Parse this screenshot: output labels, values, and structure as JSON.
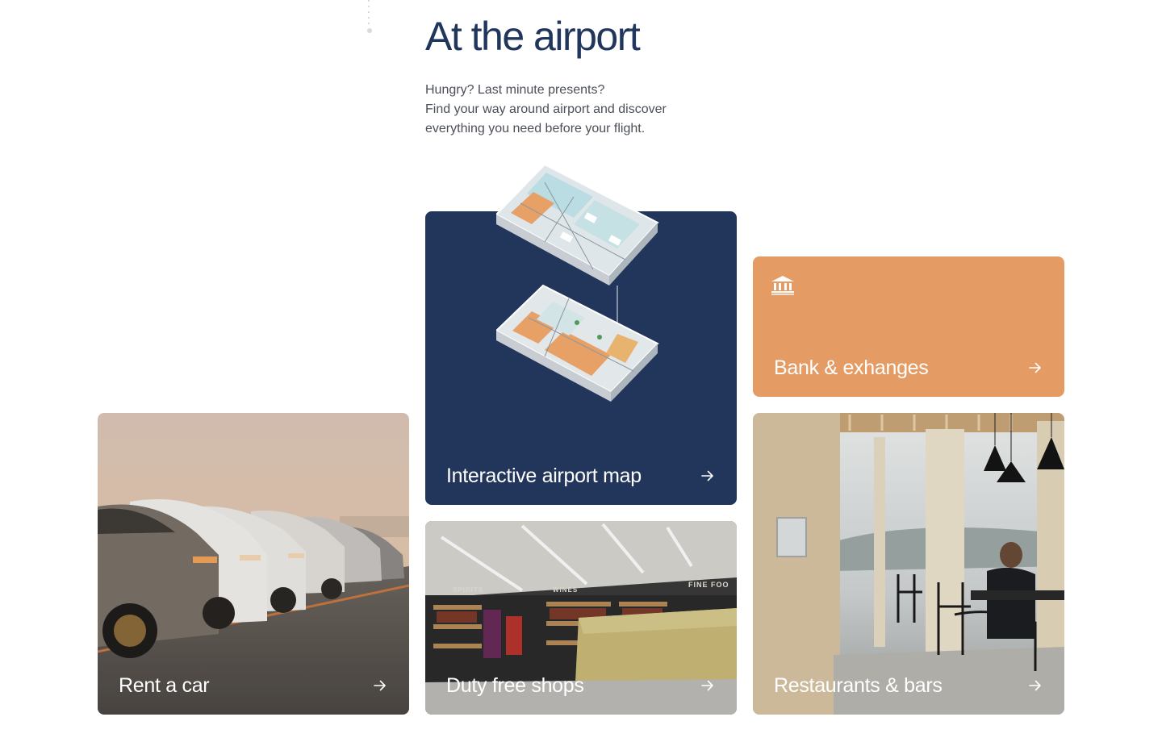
{
  "section": {
    "title": "At the airport",
    "intro_lines": [
      "Hungry? Last minute presents?",
      "Find your way around airport and discover",
      "everything you need before your flight."
    ]
  },
  "cards": {
    "map": {
      "label": "Interactive airport map",
      "icon": "arrow-right-icon",
      "background": "#22355a"
    },
    "bank": {
      "label": "Bank & exhanges",
      "icon": "bank-icon",
      "background": "#e59b64"
    },
    "car": {
      "label": "Rent a car",
      "icon": "arrow-right-icon"
    },
    "duty": {
      "label": "Duty free shops",
      "icon": "arrow-right-icon"
    },
    "restaurants": {
      "label": "Restaurants & bars",
      "icon": "arrow-right-icon"
    }
  },
  "photo_signage": {
    "spirits": "SPIRITS",
    "wines": "WINES",
    "fine_food": "FINE FOO"
  },
  "colors": {
    "accent_navy": "#22355a",
    "accent_orange": "#e59b64",
    "title": "#21365c"
  }
}
